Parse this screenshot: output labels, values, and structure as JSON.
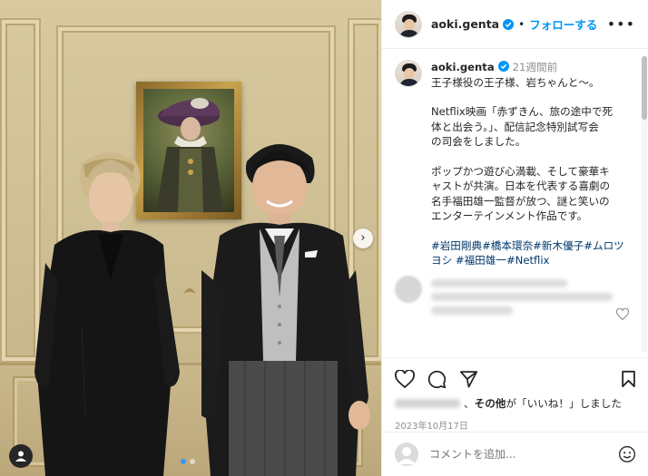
{
  "post": {
    "username": "aoki.genta",
    "follow_label": "フォローする",
    "separator": "•",
    "more_label": "•••"
  },
  "caption": {
    "username": "aoki.genta",
    "time": "21週間前",
    "line1": "王子様役の王子様、岩ちゃんと〜。",
    "line2": "Netflix映画「赤ずきん、旅の途中で死",
    "line3": "体と出会う。」、配信記念特別試写会",
    "line4": "の司会をしました。",
    "line5": "ポップかつ遊び心満載、そして豪華キ",
    "line6": "ャストが共演。日本を代表する喜劇の",
    "line7": "名手福田雄一監督が放つ、謎と笑いの",
    "line8": "エンターテインメント作品です。",
    "hashtag_line1": "#岩田剛典#橋本環奈#新木優子#ムロツ",
    "hashtag_line2": "ヨシ #福田雄一#Netflix"
  },
  "likes": {
    "text_bold": "その他",
    "text_rest": "が「いいね！」しました",
    "prefix": "、"
  },
  "date": "2023年10月17日",
  "comment_input": {
    "placeholder": "コメントを追加..."
  },
  "carousel": {
    "arrow": "›",
    "slide_count": 2,
    "active_index": 0
  },
  "colors": {
    "accent": "#0095f6",
    "verified": "#0095f6",
    "hashtag": "#00376b",
    "secondary_text": "#8e8e8e"
  },
  "icons": [
    "heart-icon",
    "comment-icon",
    "share-icon",
    "bookmark-icon",
    "emoji-icon",
    "verified-icon",
    "user-tag-icon",
    "chevron-right-icon"
  ]
}
